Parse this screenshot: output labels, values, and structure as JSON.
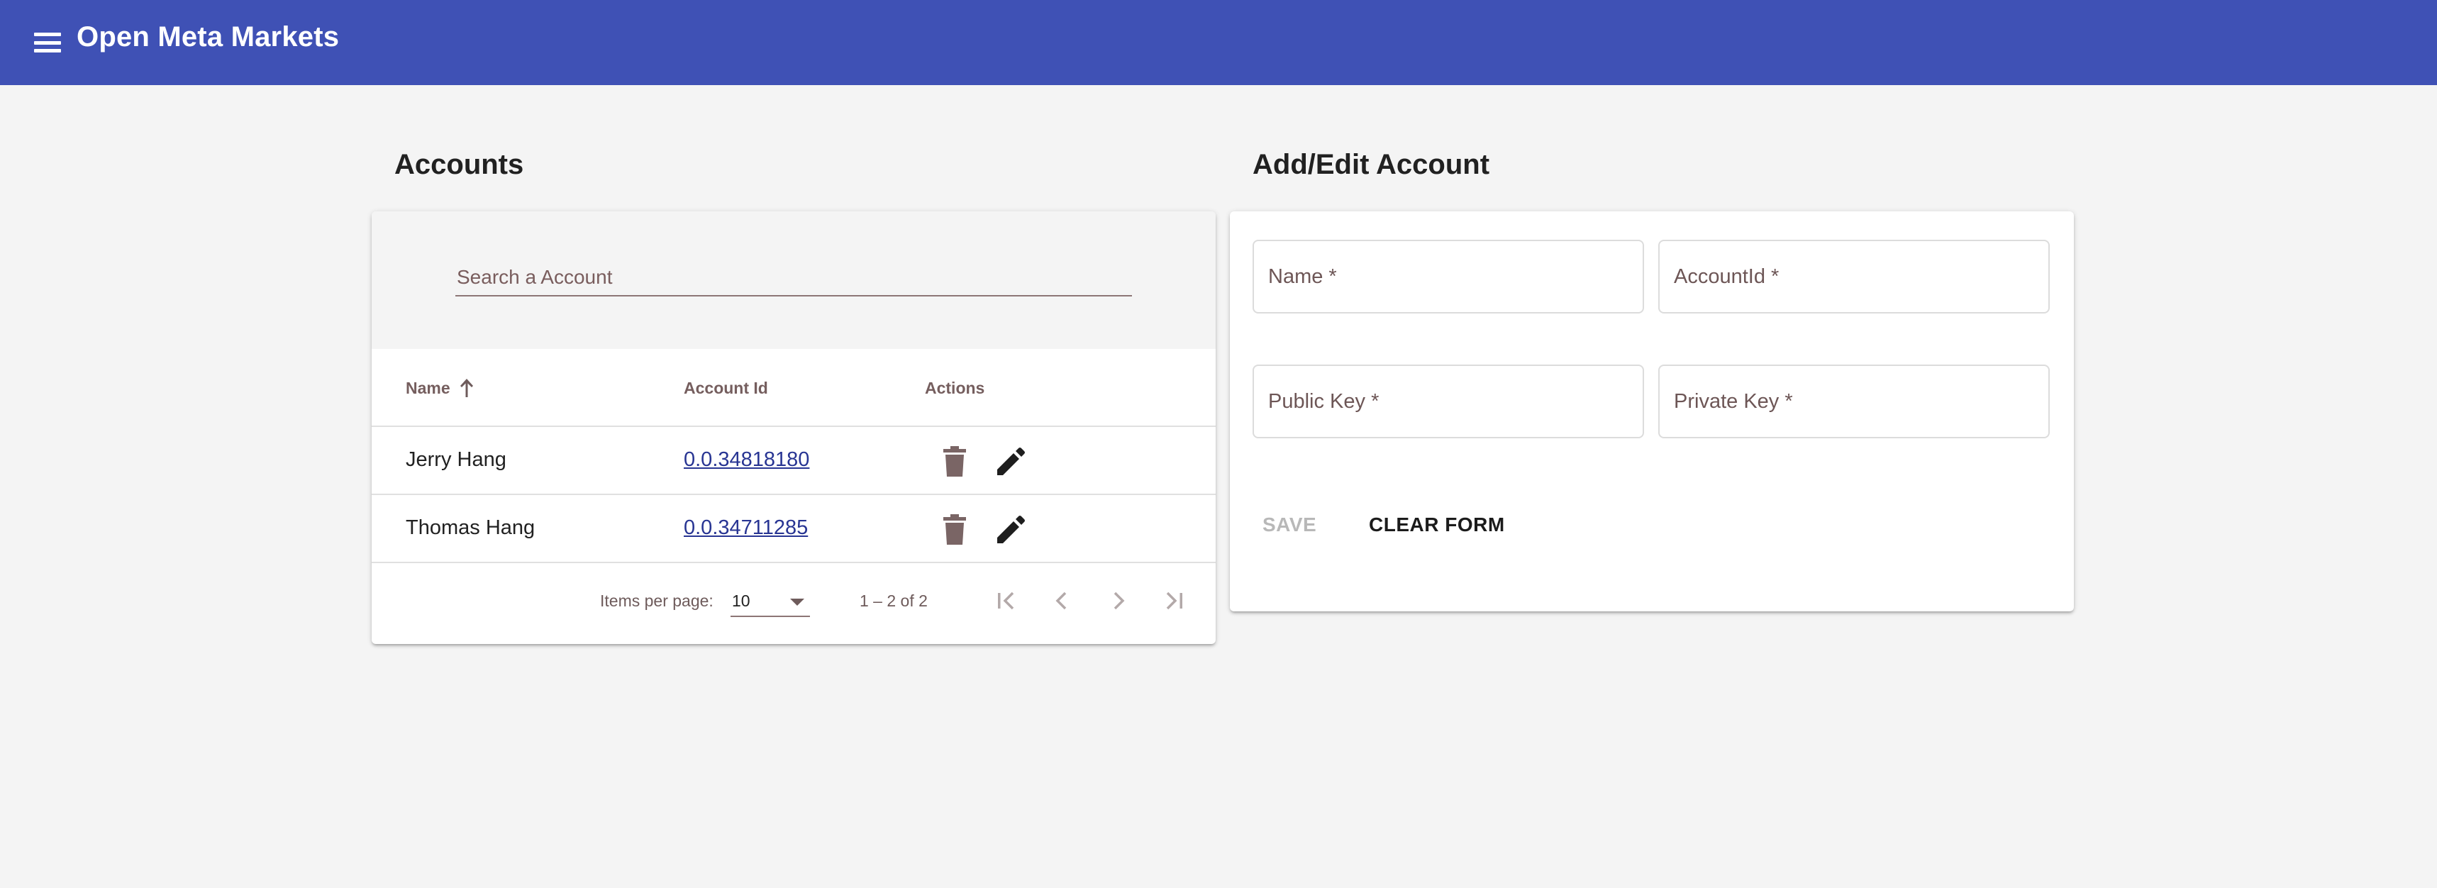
{
  "app": {
    "title": "Open Meta Markets",
    "colors": {
      "toolbar": "#3f51b5",
      "background": "#f4f4f4",
      "link": "#283593"
    }
  },
  "accounts": {
    "heading": "Accounts",
    "search": {
      "placeholder": "Search a Account",
      "value": ""
    },
    "columns": {
      "name": "Name",
      "account_id": "Account Id",
      "actions": "Actions"
    },
    "sort": {
      "column": "Name",
      "direction": "ascending"
    },
    "rows": [
      {
        "name": "Jerry Hang",
        "account_id": "0.0.34818180"
      },
      {
        "name": "Thomas Hang",
        "account_id": "0.0.34711285"
      }
    ],
    "paginator": {
      "items_per_page_label": "Items per page:",
      "items_per_page": "10",
      "range": "1 – 2 of 2"
    }
  },
  "form": {
    "heading": "Add/Edit Account",
    "fields": {
      "name": "Name *",
      "account_id": "AccountId *",
      "public_key": "Public Key *",
      "private_key": "Private Key *"
    },
    "save_label": "SAVE",
    "clear_label": "CLEAR FORM"
  }
}
